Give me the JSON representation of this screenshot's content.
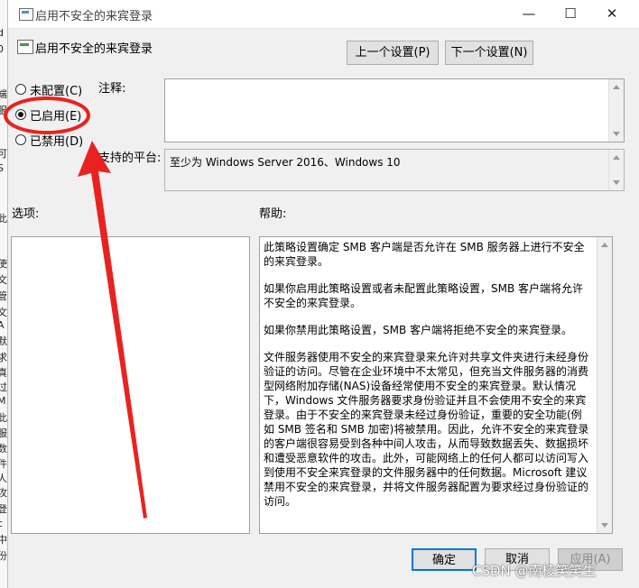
{
  "background_window": {
    "clipped_chars": [
      "d",
      "0",
      "端",
      "服",
      "可",
      "S",
      "此",
      "使",
      "文",
      "管",
      "文",
      "A",
      "默",
      "求",
      "真",
      "过",
      "M",
      "此",
      "服",
      "数",
      "件",
      "人",
      "攻",
      "登",
      "c",
      "中",
      "份"
    ]
  },
  "titlebar": {
    "title": "启用不安全的来宾登录",
    "minimize": "—",
    "maximize": "☐",
    "close": "✕"
  },
  "header": {
    "setting_name": "启用不安全的来宾登录"
  },
  "nav": {
    "prev": "上一个设置(P)",
    "next": "下一个设置(N)"
  },
  "options": [
    {
      "label": "未配置(C)",
      "checked": false
    },
    {
      "label": "已启用(E)",
      "checked": true
    },
    {
      "label": "已禁用(D)",
      "checked": false
    }
  ],
  "comment": {
    "label": "注释:",
    "value": ""
  },
  "platform": {
    "label": "支持的平台:",
    "value": "至少为 Windows Server 2016、Windows 10"
  },
  "options_panel": {
    "label": "选项:"
  },
  "help": {
    "label": "帮助:",
    "paragraphs": [
      "此策略设置确定 SMB 客户端是否允许在 SMB 服务器上进行不安全的来宾登录。",
      "如果你启用此策略设置或者未配置此策略设置，SMB 客户端将允许不安全的来宾登录。",
      "如果你禁用此策略设置，SMB 客户端将拒绝不安全的来宾登录。",
      "文件服务器使用不安全的来宾登录来允许对共享文件夹进行未经身份验证的访问。尽管在企业环境中不太常见，但充当文件服务器的消费型网络附加存储(NAS)设备经常使用不安全的来宾登录。默认情况下，Windows 文件服务器要求身份验证并且不会使用不安全的来宾登录。由于不安全的来宾登录未经过身份验证，重要的安全功能(例如 SMB 签名和 SMB 加密)将被禁用。因此，允许不安全的来宾登录的客户端很容易受到各种中间人攻击，从而导致数据丢失、数据损坏和遭受恶意软件的攻击。此外，可能网络上的任何人都可以访问写入到使用不安全来宾登录的文件服务器中的任何数据。Microsoft 建议禁用不安全的来宾登录，并将文件服务器配置为要求经过身份验证的访问。"
    ]
  },
  "footer": {
    "ok": "确定",
    "cancel": "取消",
    "apply": "应用(A)"
  },
  "watermark": "CSDN @南棱笑笑生",
  "colors": {
    "annotation_red": "#e8231f",
    "button_focus": "#0078d7"
  }
}
